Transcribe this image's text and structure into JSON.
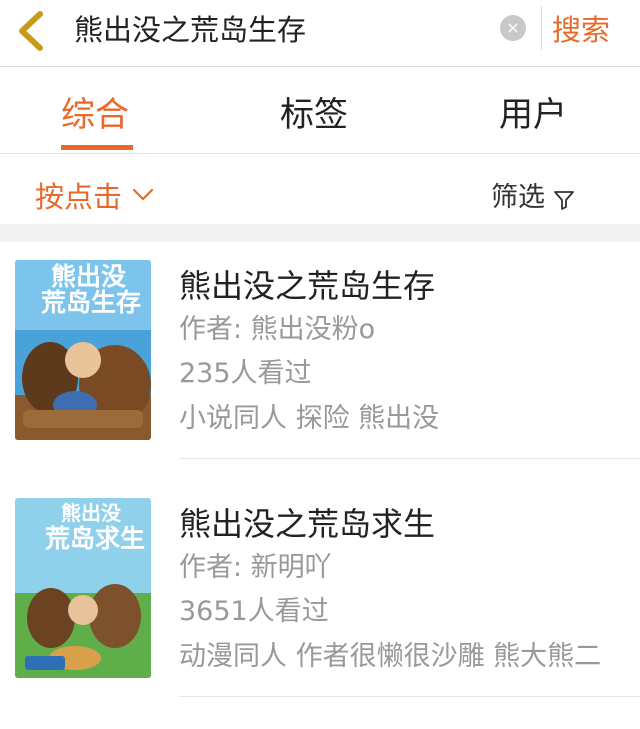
{
  "header": {
    "back_icon": "chevron-left-icon",
    "search_query": "熊出没之荒岛生存",
    "clear_icon": "clear-icon",
    "clear_glyph": "×",
    "search_button": "搜索"
  },
  "tabs": [
    {
      "label": "综合",
      "active": true
    },
    {
      "label": "标签",
      "active": false
    },
    {
      "label": "用户",
      "active": false
    }
  ],
  "filter_bar": {
    "sort_label": "按点击",
    "filter_label": "筛选"
  },
  "results": [
    {
      "title": "熊出没之荒岛生存",
      "author": "作者: 熊出没粉o",
      "views": "235人看过",
      "tags": "小说同人 探险 熊出没",
      "cover_text": [
        "熊出没",
        "荒岛生存"
      ]
    },
    {
      "title": "熊出没之荒岛求生",
      "author": "作者: 新明吖",
      "views": "3651人看过",
      "tags": "动漫同人 作者很懒很沙雕 熊大熊二",
      "cover_text": [
        "熊出没",
        "荒岛求生"
      ]
    }
  ],
  "colors": {
    "accent": "#e8692a",
    "muted_text": "#999999",
    "divider": "#e6e6e6"
  }
}
